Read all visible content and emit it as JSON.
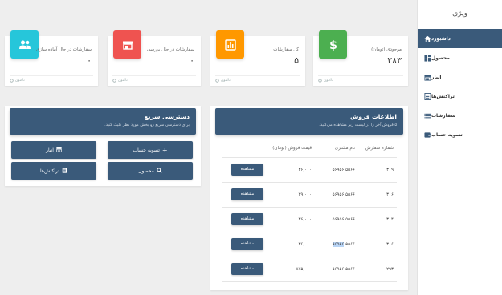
{
  "sidebar": {
    "brand": "ویژی",
    "items": [
      {
        "label": "داشبورد",
        "icon": "home-icon",
        "active": true
      },
      {
        "label": "محصول",
        "icon": "grid-icon"
      },
      {
        "label": "انبار",
        "icon": "warehouse-icon"
      },
      {
        "label": "تراکنش‌ها",
        "icon": "list-icon"
      },
      {
        "label": "سفارشات",
        "icon": "lines-icon"
      },
      {
        "label": "تسویه حساب",
        "icon": "wallet-icon"
      }
    ]
  },
  "stats": [
    {
      "title": "موجودی (تومان)",
      "value": "۲۸۳",
      "icon": "dollar-icon",
      "color": "#4caf50",
      "footer": "تاکنون"
    },
    {
      "title": "کل سفارشات",
      "value": "۵",
      "icon": "chart-icon",
      "color": "#ff9800",
      "footer": "تاکنون"
    },
    {
      "title": "سفارشات در حال بررسی",
      "value": "۰",
      "icon": "store-icon",
      "color": "#ef5350",
      "footer": "تاکنون"
    },
    {
      "title": "سفارشات در حال آماده سازی",
      "value": "۰",
      "icon": "people-icon",
      "color": "#26c6da",
      "footer": "تاکنون"
    }
  ],
  "sales": {
    "title": "اطلاعات فروش",
    "subtitle": "۵ فروش آخر را در لیست زیر مشاهده می‌کنید.",
    "columns": [
      "شماره سفارش",
      "نام مشتری",
      "قیمت فروش (تومان)",
      ""
    ],
    "rows": [
      {
        "order": "۳۱۹",
        "customer": "۵۵۶۶ ۵۶۹۵۶",
        "price": "۳۶,۰۰۰",
        "action": "مشاهده"
      },
      {
        "order": "۳۱۶",
        "customer": "۵۵۶۶ ۵۶۹۵۶",
        "price": "۲۹,۰۰۰",
        "action": "مشاهده"
      },
      {
        "order": "۳۱۴",
        "customer": "۵۵۶۶ ۵۶۹۵۶",
        "price": "۳۶,۰۰۰",
        "action": "مشاهده"
      },
      {
        "order": "۳۰۶",
        "customer_a": "۵۵۶۶",
        "customer_b": "۵۶۹۵۶",
        "price": "۳۶,۰۰۰",
        "action": "مشاهده"
      },
      {
        "order": "۲۹۳",
        "customer": "۵۵۶۶ ۵۶۹۵۶",
        "price": "۸۷۵,۰۰۰",
        "action": "مشاهده"
      }
    ]
  },
  "quick": {
    "title": "دسترسی سریع",
    "subtitle": "برای دسترسی سریع رو بخش مورد نظر کلیک کنید.",
    "buttons": [
      {
        "label": "تسویه حساب",
        "icon": "plus-icon"
      },
      {
        "label": "انبار",
        "icon": "warehouse-icon"
      },
      {
        "label": "محصول",
        "icon": "search-icon"
      },
      {
        "label": "تراکنش‌ها",
        "icon": "receipt-icon"
      }
    ]
  }
}
